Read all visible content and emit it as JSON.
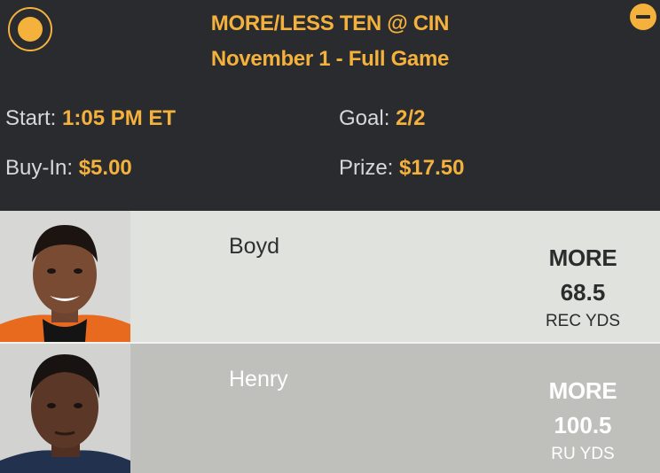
{
  "contest": {
    "title": "MORE/LESS TEN @ CIN",
    "subtitle": "November 1 - Full Game",
    "start": {
      "label": "Start:",
      "value": "1:05 PM ET"
    },
    "goal": {
      "label": "Goal:",
      "value": "2/2"
    },
    "buy_in": {
      "label": "Buy-In:",
      "value": "$5.00"
    },
    "prize": {
      "label": "Prize:",
      "value": "$17.50"
    }
  },
  "colors": {
    "accent": "#f4b13c",
    "header_bg": "#2a2b2f",
    "row1_bg": "#e0e2dd",
    "row2_bg": "#bfc0bb"
  },
  "picks": [
    {
      "player": "Boyd",
      "choice": "MORE",
      "line": "68.5",
      "stat": "REC YDS"
    },
    {
      "player": "Henry",
      "choice": "MORE",
      "line": "100.5",
      "stat": "RU YDS"
    }
  ]
}
